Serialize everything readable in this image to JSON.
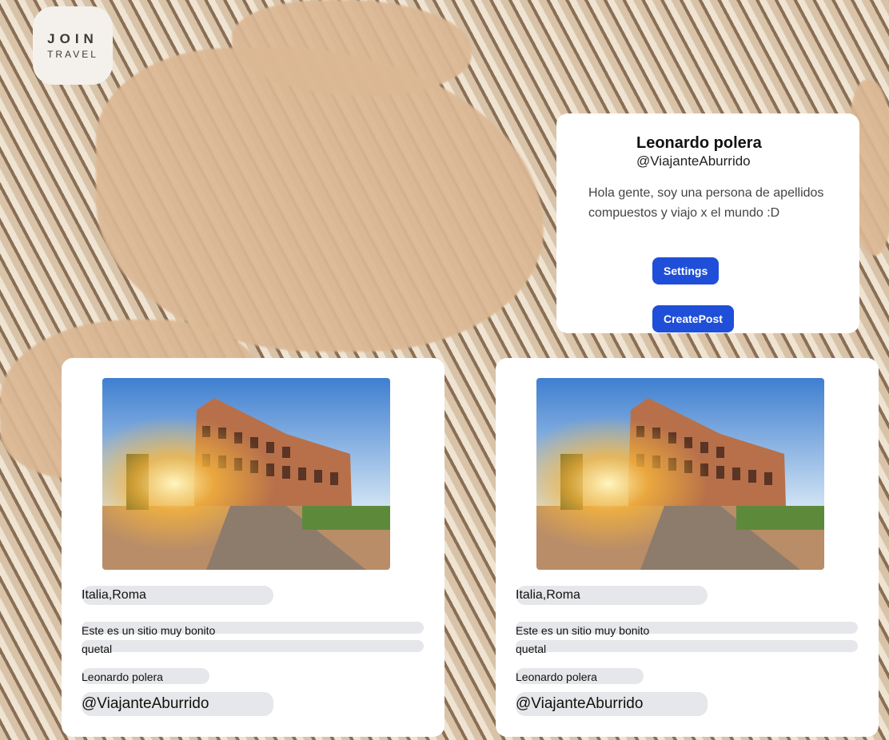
{
  "logo": {
    "line1": "JOIN",
    "line2": "TRAVEL"
  },
  "profile": {
    "name": "Leonardo polera",
    "handle": "@ViajanteAburrido",
    "bio": "Hola gente, soy una persona de apellidos compuestos y viajo x el mundo :D",
    "settings_label": "Settings",
    "create_post_label": "CreatePost"
  },
  "posts": [
    {
      "location": "Italia,Roma",
      "desc_line1": "Este es un sitio muy bonito",
      "desc_line2": "quetal",
      "author": "Leonardo polera",
      "handle": "@ViajanteAburrido"
    },
    {
      "location": "Italia,Roma",
      "desc_line1": "Este es un sitio muy bonito",
      "desc_line2": "quetal",
      "author": "Leonardo polera",
      "handle": "@ViajanteAburrido"
    }
  ],
  "colors": {
    "accent": "#1f4fd8",
    "pill": "#e6e7ea",
    "card": "#ffffff"
  }
}
